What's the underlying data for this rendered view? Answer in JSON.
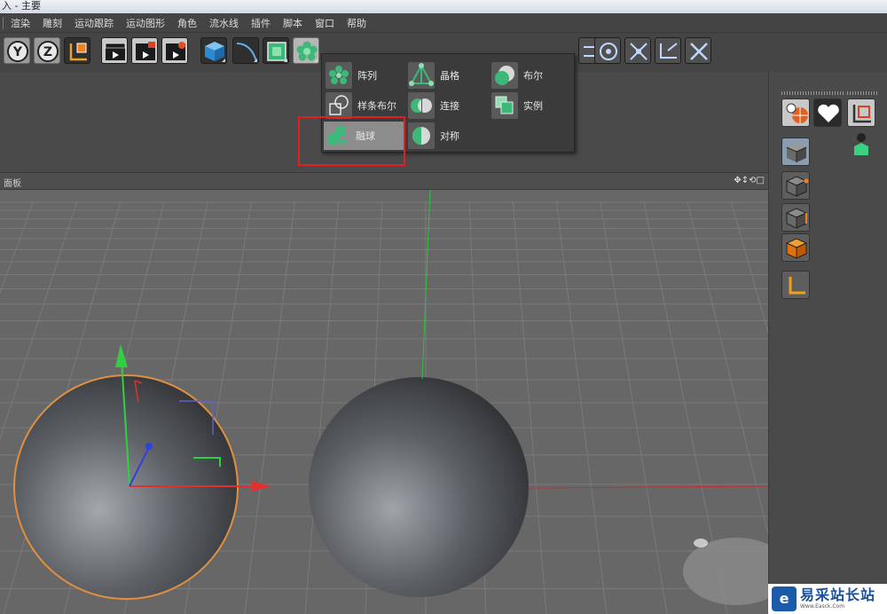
{
  "window": {
    "title": "入 - 主要"
  },
  "menu": {
    "items": [
      "渲染",
      "雕刻",
      "运动跟踪",
      "运动图形",
      "角色",
      "流水线",
      "插件",
      "脚本",
      "窗口",
      "帮助"
    ]
  },
  "toolbar": {
    "axis_y": "Y",
    "axis_z": "Z"
  },
  "popup": {
    "items": [
      {
        "label": "阵列",
        "icon": "array-icon"
      },
      {
        "label": "晶格",
        "icon": "atom-array-icon"
      },
      {
        "label": "布尔",
        "icon": "boole-icon"
      },
      {
        "label": "样条布尔",
        "icon": "spline-boole-icon"
      },
      {
        "label": "连接",
        "icon": "connect-icon"
      },
      {
        "label": "实例",
        "icon": "instance-icon"
      },
      {
        "label": "融球",
        "icon": "metaball-icon",
        "highlighted": true
      },
      {
        "label": "对称",
        "icon": "symmetry-icon"
      }
    ]
  },
  "viewport": {
    "label": "面板",
    "nav_icons": "✥↕⟲□"
  },
  "watermark": {
    "cn": "易采站长站",
    "en": "Www.Easck.Com"
  },
  "colors": {
    "accent_highlight": "#8c8c8c",
    "selection_red": "#e02020",
    "axis_x": "#e03030",
    "axis_y": "#30d040",
    "axis_z": "#3040e0"
  }
}
